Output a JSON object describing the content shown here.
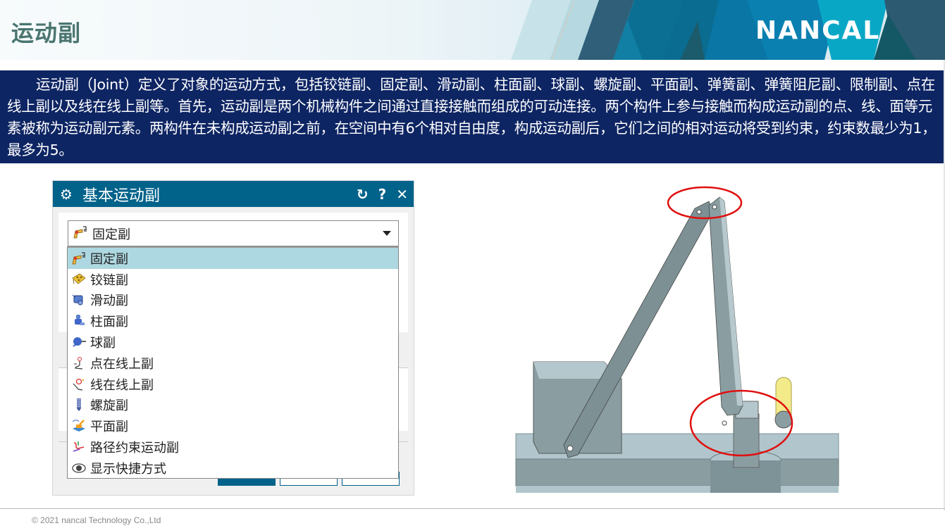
{
  "header": {
    "title": "运动副",
    "logo_text": "NANCAL"
  },
  "intro": {
    "text": "运动副（Joint）定义了对象的运动方式，包括铰链副、固定副、滑动副、柱面副、球副、螺旋副、平面副、弹簧副、弹簧阻尼副、限制副、点在线上副以及线在线上副等。首先，运动副是两个机械构件之间通过直接接触而组成的可动连接。两个构件上参与接触而构成运动副的点、线、面等元素被称为运动副元素。两构件在未构成运动副之前，在空间中有6个相对自由度，构成运动副后，它们之间的相对运动将受到约束，约束数最少为1，最多为5。"
  },
  "dialog": {
    "title": "基本运动副",
    "title_icon": "gear-icon",
    "reset_glyph": "↻",
    "help_glyph": "?",
    "close_glyph": "✕",
    "select": {
      "value": "固定副",
      "icon": "fixed-joint-icon"
    },
    "options": [
      {
        "label": "固定副",
        "icon": "fixed-joint-icon",
        "selected": true
      },
      {
        "label": "铰链副",
        "icon": "revolute-joint-icon",
        "selected": false
      },
      {
        "label": "滑动副",
        "icon": "slider-joint-icon",
        "selected": false
      },
      {
        "label": "柱面副",
        "icon": "cylindrical-joint-icon",
        "selected": false
      },
      {
        "label": "球副",
        "icon": "ball-joint-icon",
        "selected": false
      },
      {
        "label": "点在线上副",
        "icon": "point-on-curve-icon",
        "selected": false
      },
      {
        "label": "线在线上副",
        "icon": "curve-on-curve-icon",
        "selected": false
      },
      {
        "label": "螺旋副",
        "icon": "screw-joint-icon",
        "selected": false
      },
      {
        "label": "平面副",
        "icon": "planar-joint-icon",
        "selected": false
      },
      {
        "label": "路径约束运动副",
        "icon": "path-constraint-icon",
        "selected": false
      },
      {
        "label": "显示快捷方式",
        "icon": "eye-icon",
        "selected": false
      }
    ]
  },
  "colors": {
    "title_text": "#4a7570",
    "intro_bg": "#0e2563",
    "dialog_titlebar": "#01628a",
    "selected_option": "#add8e1",
    "highlight_circle": "#e01010"
  },
  "footer": {
    "copyright": "© 2021 nancal Technology Co.,Ltd"
  }
}
